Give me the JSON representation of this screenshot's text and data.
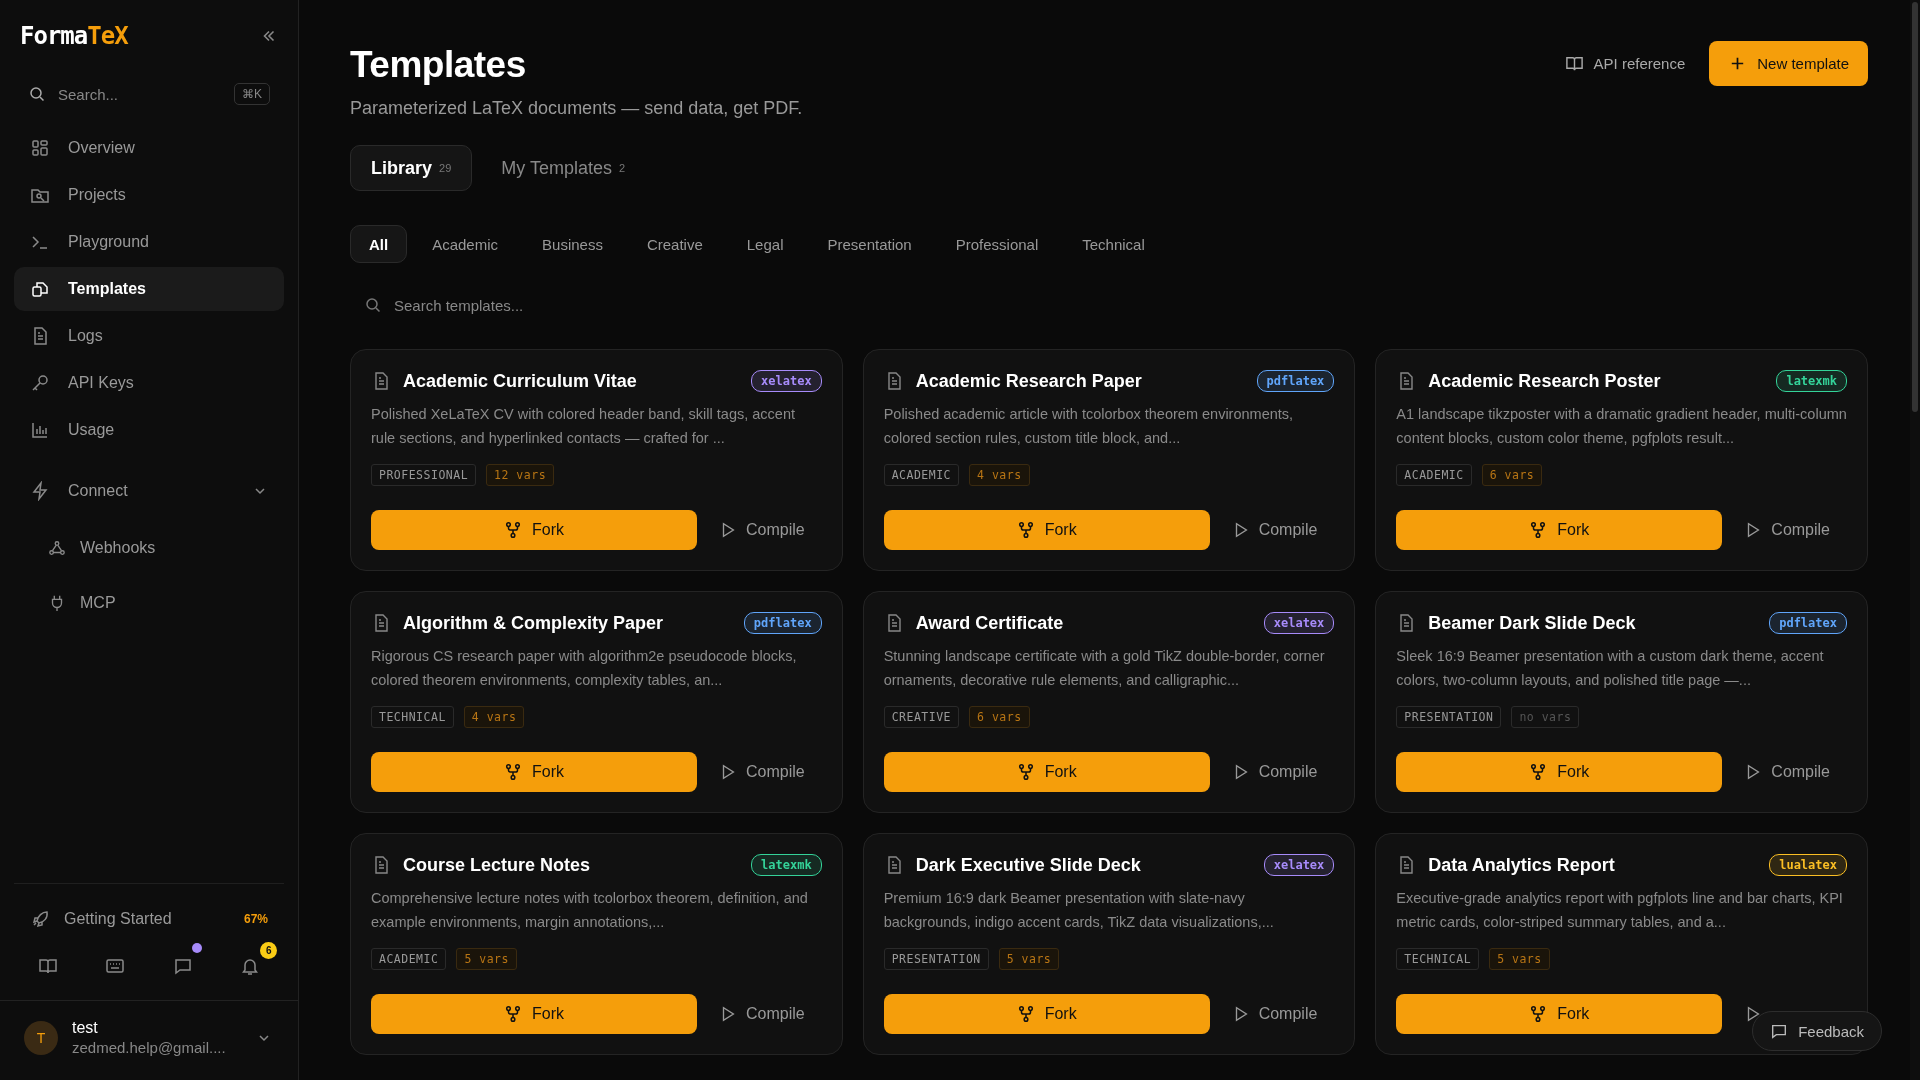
{
  "sidebar": {
    "logo": {
      "first": "Forma",
      "second": "TeX"
    },
    "search": {
      "placeholder": "Search...",
      "shortcut": "⌘K"
    },
    "items": [
      {
        "label": "Overview",
        "selected": false
      },
      {
        "label": "Projects",
        "selected": false
      },
      {
        "label": "Playground",
        "selected": false
      },
      {
        "label": "Templates",
        "selected": true
      },
      {
        "label": "Logs",
        "selected": false
      },
      {
        "label": "API Keys",
        "selected": false
      },
      {
        "label": "Usage",
        "selected": false
      }
    ],
    "connect": {
      "label": "Connect",
      "expanded": true,
      "children": [
        {
          "label": "Webhooks"
        },
        {
          "label": "MCP"
        }
      ]
    },
    "getting_started": {
      "label": "Getting Started",
      "progress": "67%"
    },
    "notifications": {
      "count": "6",
      "chat_unread": true
    },
    "user": {
      "initial": "T",
      "name": "test",
      "email": "zedmed.help@gmail...."
    }
  },
  "header": {
    "title": "Templates",
    "subtitle": "Parameterized LaTeX documents — send data, get PDF.",
    "api_link": "API reference",
    "new_button": "New template"
  },
  "tabs": [
    {
      "label": "Library",
      "count": "29",
      "selected": true
    },
    {
      "label": "My Templates",
      "count": "2",
      "selected": false
    }
  ],
  "filters": [
    {
      "label": "All",
      "selected": true
    },
    {
      "label": "Academic",
      "selected": false
    },
    {
      "label": "Business",
      "selected": false
    },
    {
      "label": "Creative",
      "selected": false
    },
    {
      "label": "Legal",
      "selected": false
    },
    {
      "label": "Presentation",
      "selected": false
    },
    {
      "label": "Professional",
      "selected": false
    },
    {
      "label": "Technical",
      "selected": false
    }
  ],
  "template_search": {
    "placeholder": "Search templates..."
  },
  "cards": [
    {
      "title": "Academic Curriculum Vitae",
      "engine": "xelatex",
      "color": "#a78bfa",
      "description": "Polished XeLaTeX CV with colored header band, skill tags, accent rule sections, and hyperlinked contacts — crafted for ...",
      "category": "PROFESSIONAL",
      "vars": "12 vars",
      "vars_greyed": false,
      "fork": "Fork",
      "compile": "Compile"
    },
    {
      "title": "Academic Research Paper",
      "engine": "pdflatex",
      "color": "#60a5fa",
      "description": "Polished academic article with tcolorbox theorem environments, colored section rules, custom title block, and...",
      "category": "ACADEMIC",
      "vars": "4 vars",
      "vars_greyed": false,
      "fork": "Fork",
      "compile": "Compile"
    },
    {
      "title": "Academic Research Poster",
      "engine": "latexmk",
      "color": "#34d399",
      "description": "A1 landscape tikzposter with a dramatic gradient header, multi-column content blocks, custom color theme, pgfplots result...",
      "category": "ACADEMIC",
      "vars": "6 vars",
      "vars_greyed": false,
      "fork": "Fork",
      "compile": "Compile"
    },
    {
      "title": "Algorithm & Complexity Paper",
      "engine": "pdflatex",
      "color": "#60a5fa",
      "description": "Rigorous CS research paper with algorithm2e pseudocode blocks, colored theorem environments, complexity tables, an...",
      "category": "TECHNICAL",
      "vars": "4 vars",
      "vars_greyed": false,
      "fork": "Fork",
      "compile": "Compile"
    },
    {
      "title": "Award Certificate",
      "engine": "xelatex",
      "color": "#a78bfa",
      "description": "Stunning landscape certificate with a gold TikZ double-border, corner ornaments, decorative rule elements, and calligraphic...",
      "category": "CREATIVE",
      "vars": "6 vars",
      "vars_greyed": false,
      "fork": "Fork",
      "compile": "Compile"
    },
    {
      "title": "Beamer Dark Slide Deck",
      "engine": "pdflatex",
      "color": "#60a5fa",
      "description": "Sleek 16:9 Beamer presentation with a custom dark theme, accent colors, two-column layouts, and polished title page —...",
      "category": "PRESENTATION",
      "vars": "no vars",
      "vars_greyed": true,
      "fork": "Fork",
      "compile": "Compile"
    },
    {
      "title": "Course Lecture Notes",
      "engine": "latexmk",
      "color": "#34d399",
      "description": "Comprehensive lecture notes with tcolorbox theorem, definition, and example environments, margin annotations,...",
      "category": "ACADEMIC",
      "vars": "5 vars",
      "vars_greyed": false,
      "fork": "Fork",
      "compile": "Compile"
    },
    {
      "title": "Dark Executive Slide Deck",
      "engine": "xelatex",
      "color": "#a78bfa",
      "description": "Premium 16:9 dark Beamer presentation with slate-navy backgrounds, indigo accent cards, TikZ data visualizations,...",
      "category": "PRESENTATION",
      "vars": "5 vars",
      "vars_greyed": false,
      "fork": "Fork",
      "compile": "Compile"
    },
    {
      "title": "Data Analytics Report",
      "engine": "lualatex",
      "color": "#fbbf24",
      "description": "Executive-grade analytics report with pgfplots line and bar charts, KPI metric cards, color-striped summary tables, and a...",
      "category": "TECHNICAL",
      "vars": "5 vars",
      "vars_greyed": false,
      "fork": "Fork"
    }
  ],
  "feedback": "Feedback"
}
